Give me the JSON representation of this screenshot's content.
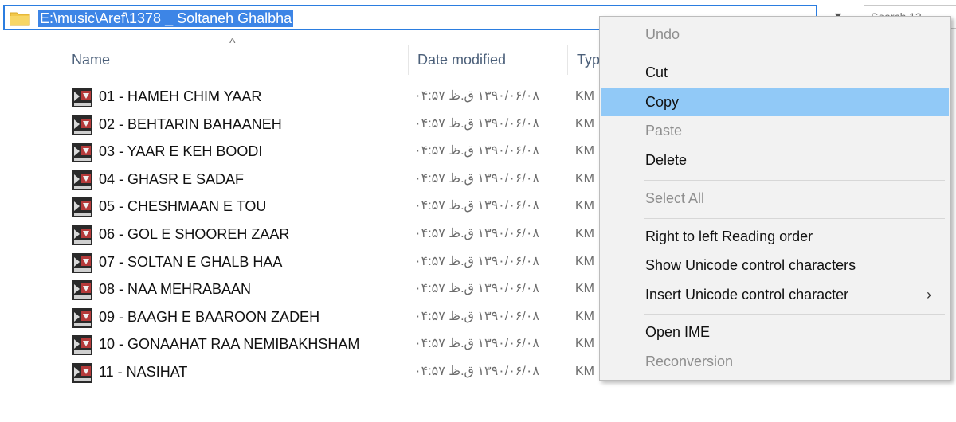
{
  "address_bar": {
    "path": "E:\\music\\Aref\\1378 _ Soltaneh Ghalbha"
  },
  "search": {
    "text": "Search 13"
  },
  "columns": {
    "name": "Name",
    "date_modified": "Date modified",
    "type": "Typ"
  },
  "files": [
    {
      "name": "01 - HAMEH CHIM YAAR",
      "date": "۱۳۹۰/۰۶/۰۸ ق.ظ ۰۴:۵۷",
      "type": "KM"
    },
    {
      "name": "02 - BEHTARIN BAHAANEH",
      "date": "۱۳۹۰/۰۶/۰۸ ق.ظ ۰۴:۵۷",
      "type": "KM"
    },
    {
      "name": "03 - YAAR E KEH BOODI",
      "date": "۱۳۹۰/۰۶/۰۸ ق.ظ ۰۴:۵۷",
      "type": "KM"
    },
    {
      "name": "04 - GHASR E SADAF",
      "date": "۱۳۹۰/۰۶/۰۸ ق.ظ ۰۴:۵۷",
      "type": "KM"
    },
    {
      "name": "05 - CHESHMAAN E TOU",
      "date": "۱۳۹۰/۰۶/۰۸ ق.ظ ۰۴:۵۷",
      "type": "KM"
    },
    {
      "name": "06 - GOL E SHOOREH ZAAR",
      "date": "۱۳۹۰/۰۶/۰۸ ق.ظ ۰۴:۵۷",
      "type": "KM"
    },
    {
      "name": "07 - SOLTAN E GHALB HAA",
      "date": "۱۳۹۰/۰۶/۰۸ ق.ظ ۰۴:۵۷",
      "type": "KM"
    },
    {
      "name": "08 - NAA MEHRABAAN",
      "date": "۱۳۹۰/۰۶/۰۸ ق.ظ ۰۴:۵۷",
      "type": "KM"
    },
    {
      "name": "09 - BAAGH E BAAROON ZADEH",
      "date": "۱۳۹۰/۰۶/۰۸ ق.ظ ۰۴:۵۷",
      "type": "KM"
    },
    {
      "name": "10 - GONAAHAT RAA NEMIBAKHSHAM",
      "date": "۱۳۹۰/۰۶/۰۸ ق.ظ ۰۴:۵۷",
      "type": "KM"
    },
    {
      "name": "11 - NASIHAT",
      "date": "۱۳۹۰/۰۶/۰۸ ق.ظ ۰۴:۵۷",
      "type": "KM"
    }
  ],
  "context_menu": {
    "undo": "Undo",
    "cut": "Cut",
    "copy": "Copy",
    "paste": "Paste",
    "delete": "Delete",
    "select_all": "Select All",
    "rtl": "Right to left Reading order",
    "show_unicode": "Show Unicode control characters",
    "insert_unicode": "Insert Unicode control character",
    "open_ime": "Open IME",
    "reconversion": "Reconversion"
  },
  "colors": {
    "selection": "#3d85e6",
    "menu_highlight": "#91c9f7",
    "address_border": "#2b7de0"
  }
}
